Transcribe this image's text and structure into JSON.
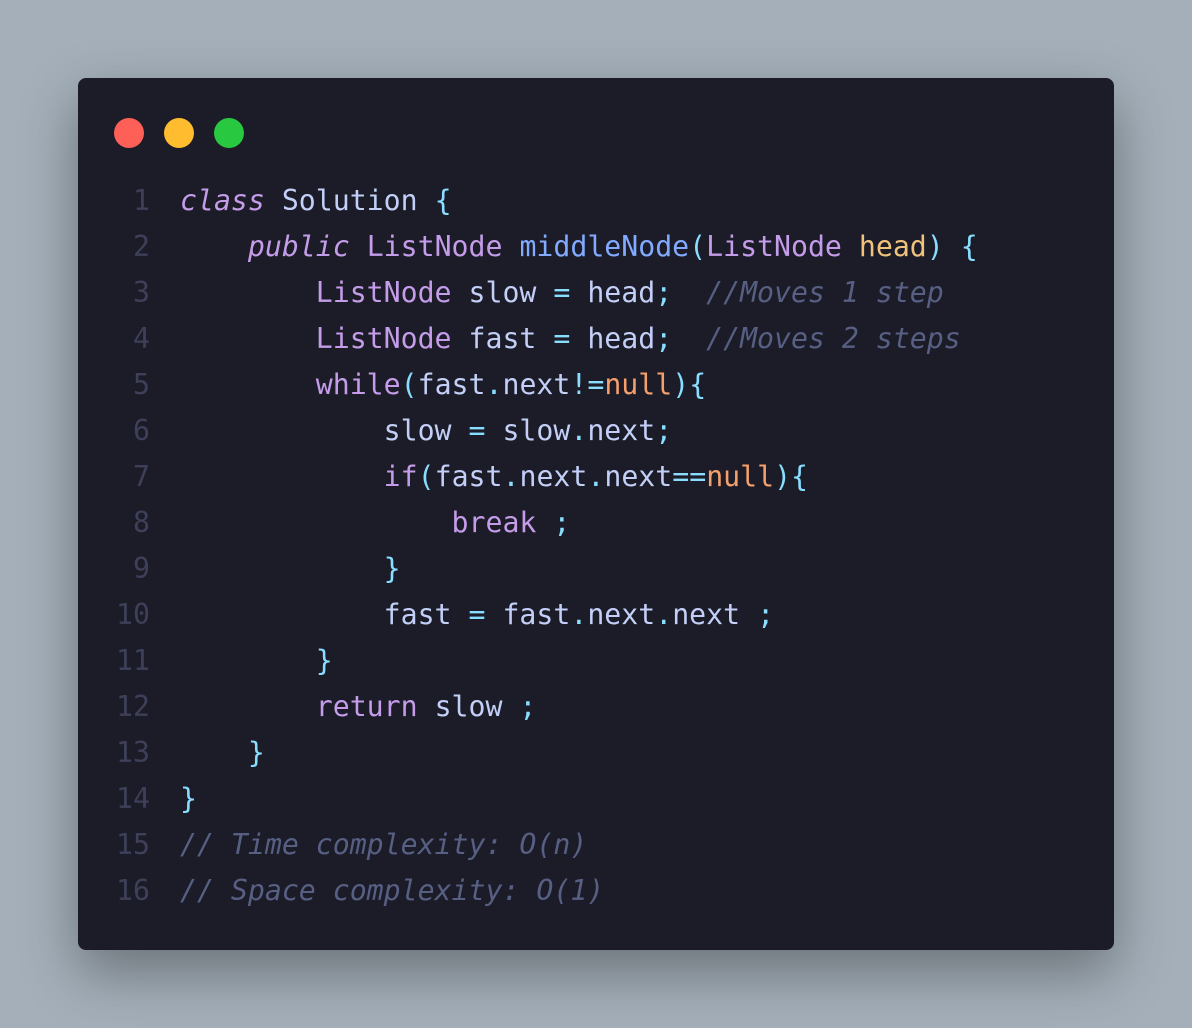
{
  "window": {
    "controls": [
      {
        "name": "close",
        "color": "#fe5f57"
      },
      {
        "name": "minimize",
        "color": "#febc2e"
      },
      {
        "name": "zoom",
        "color": "#28c840"
      }
    ]
  },
  "code": {
    "language": "java",
    "lines": [
      {
        "num": "1",
        "tokens": [
          {
            "t": "class",
            "k": "kw it"
          },
          {
            "t": " Solution "
          },
          {
            "t": "{",
            "k": "pu"
          }
        ]
      },
      {
        "num": "2",
        "tokens": [
          {
            "t": "    "
          },
          {
            "t": "public",
            "k": "kw it"
          },
          {
            "t": " "
          },
          {
            "t": "ListNode",
            "k": "ty"
          },
          {
            "t": " "
          },
          {
            "t": "middleNode",
            "k": "fn"
          },
          {
            "t": "(",
            "k": "pu"
          },
          {
            "t": "ListNode",
            "k": "ty"
          },
          {
            "t": " "
          },
          {
            "t": "head",
            "k": "pa"
          },
          {
            "t": ")",
            "k": "pu"
          },
          {
            "t": " "
          },
          {
            "t": "{",
            "k": "pu"
          }
        ]
      },
      {
        "num": "3",
        "tokens": [
          {
            "t": "        "
          },
          {
            "t": "ListNode",
            "k": "ty"
          },
          {
            "t": " slow "
          },
          {
            "t": "=",
            "k": "pu"
          },
          {
            "t": " head"
          },
          {
            "t": ";",
            "k": "pu"
          },
          {
            "t": "  "
          },
          {
            "t": "//Moves 1 step",
            "k": "co"
          }
        ]
      },
      {
        "num": "4",
        "tokens": [
          {
            "t": "        "
          },
          {
            "t": "ListNode",
            "k": "ty"
          },
          {
            "t": " fast "
          },
          {
            "t": "=",
            "k": "pu"
          },
          {
            "t": " head"
          },
          {
            "t": ";",
            "k": "pu"
          },
          {
            "t": "  "
          },
          {
            "t": "//Moves 2 steps",
            "k": "co"
          }
        ]
      },
      {
        "num": "5",
        "tokens": [
          {
            "t": "        "
          },
          {
            "t": "while",
            "k": "kw"
          },
          {
            "t": "(",
            "k": "pu"
          },
          {
            "t": "fast"
          },
          {
            "t": ".",
            "k": "pu"
          },
          {
            "t": "next"
          },
          {
            "t": "!=",
            "k": "pu"
          },
          {
            "t": "null",
            "k": "nu"
          },
          {
            "t": "){",
            "k": "pu"
          }
        ]
      },
      {
        "num": "6",
        "tokens": [
          {
            "t": "            slow "
          },
          {
            "t": "=",
            "k": "pu"
          },
          {
            "t": " slow"
          },
          {
            "t": ".",
            "k": "pu"
          },
          {
            "t": "next"
          },
          {
            "t": ";",
            "k": "pu"
          }
        ]
      },
      {
        "num": "7",
        "tokens": [
          {
            "t": "            "
          },
          {
            "t": "if",
            "k": "kw"
          },
          {
            "t": "(",
            "k": "pu"
          },
          {
            "t": "fast"
          },
          {
            "t": ".",
            "k": "pu"
          },
          {
            "t": "next"
          },
          {
            "t": ".",
            "k": "pu"
          },
          {
            "t": "next"
          },
          {
            "t": "==",
            "k": "pu"
          },
          {
            "t": "null",
            "k": "nu"
          },
          {
            "t": "){",
            "k": "pu"
          }
        ]
      },
      {
        "num": "8",
        "tokens": [
          {
            "t": "                "
          },
          {
            "t": "break",
            "k": "kw"
          },
          {
            "t": " "
          },
          {
            "t": ";",
            "k": "pu"
          }
        ]
      },
      {
        "num": "9",
        "tokens": [
          {
            "t": "            "
          },
          {
            "t": "}",
            "k": "pu"
          }
        ]
      },
      {
        "num": "10",
        "tokens": [
          {
            "t": "            fast "
          },
          {
            "t": "=",
            "k": "pu"
          },
          {
            "t": " fast"
          },
          {
            "t": ".",
            "k": "pu"
          },
          {
            "t": "next"
          },
          {
            "t": ".",
            "k": "pu"
          },
          {
            "t": "next "
          },
          {
            "t": ";",
            "k": "pu"
          }
        ]
      },
      {
        "num": "11",
        "tokens": [
          {
            "t": "        "
          },
          {
            "t": "}",
            "k": "pu"
          }
        ]
      },
      {
        "num": "12",
        "tokens": [
          {
            "t": "        "
          },
          {
            "t": "return",
            "k": "kw"
          },
          {
            "t": " slow "
          },
          {
            "t": ";",
            "k": "pu"
          }
        ]
      },
      {
        "num": "13",
        "tokens": [
          {
            "t": "    "
          },
          {
            "t": "}",
            "k": "pu"
          }
        ]
      },
      {
        "num": "14",
        "tokens": [
          {
            "t": "}",
            "k": "pu"
          }
        ]
      },
      {
        "num": "15",
        "tokens": [
          {
            "t": "// Time complexity: O(n)",
            "k": "co"
          }
        ]
      },
      {
        "num": "16",
        "tokens": [
          {
            "t": "// Space complexity: O(1)",
            "k": "co"
          }
        ]
      }
    ]
  }
}
